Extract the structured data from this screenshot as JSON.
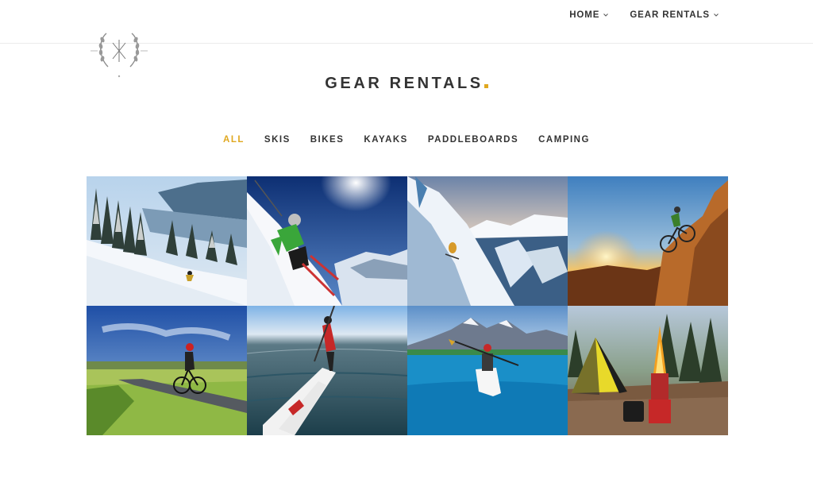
{
  "nav": {
    "items": [
      {
        "label": "HOME"
      },
      {
        "label": "GEAR RENTALS"
      }
    ]
  },
  "header": {
    "title": "GEAR RENTALS",
    "accent_color": "#e0a820"
  },
  "filters": {
    "items": [
      {
        "label": "ALL",
        "active": true
      },
      {
        "label": "SKIS",
        "active": false
      },
      {
        "label": "BIKES",
        "active": false
      },
      {
        "label": "KAYAKS",
        "active": false
      },
      {
        "label": "PADDLEBOARDS",
        "active": false
      },
      {
        "label": "CAMPING",
        "active": false
      }
    ]
  },
  "gallery": {
    "tiles": [
      {
        "subject": "skier in snowy forest above lake"
      },
      {
        "subject": "skier in green jacket carving"
      },
      {
        "subject": "skier on steep powder slope"
      },
      {
        "subject": "mountain biker at sunset on rocks"
      },
      {
        "subject": "road cyclist on country road"
      },
      {
        "subject": "paddleboarder on lake"
      },
      {
        "subject": "kayaker on turquoise lake"
      },
      {
        "subject": "tent with fire pit"
      }
    ]
  }
}
